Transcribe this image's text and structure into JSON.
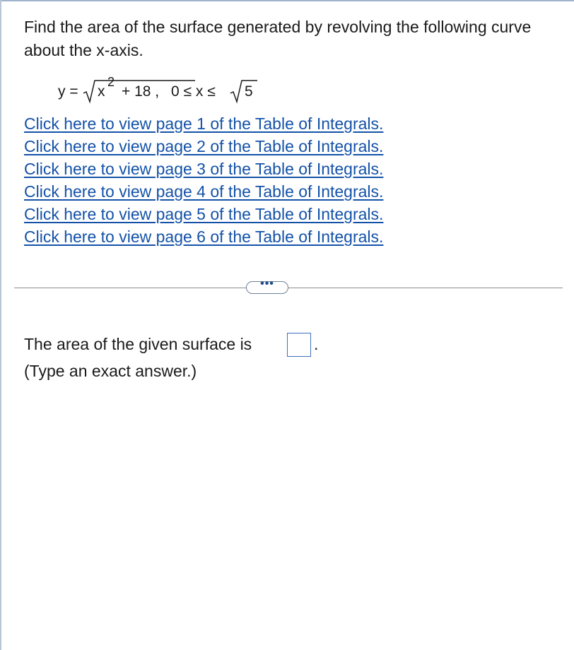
{
  "question": {
    "text": "Find the area of the surface generated by revolving the following curve about the x-axis."
  },
  "equation": {
    "lhs": "y =",
    "radicand_var": "x",
    "exponent": "2",
    "radicand_rest": "+ 18 ,",
    "bounds_prefix": "0 ≤ x ≤",
    "bound_radicand": "5"
  },
  "links": [
    "Click here to view page 1 of the Table of Integrals.",
    "Click here to view page 2 of the Table of Integrals.",
    "Click here to view page 3 of the Table of Integrals.",
    "Click here to view page 4 of the Table of Integrals.",
    "Click here to view page 5 of the Table of Integrals.",
    "Click here to view page 6 of the Table of Integrals."
  ],
  "expand_button": {
    "label": "•••"
  },
  "answer": {
    "prompt": "The area of the given surface is",
    "value": "",
    "suffix": ".",
    "hint": "(Type an exact answer.)"
  },
  "colors": {
    "link": "#1452a8",
    "answer_box_border": "#3d6fc0"
  }
}
